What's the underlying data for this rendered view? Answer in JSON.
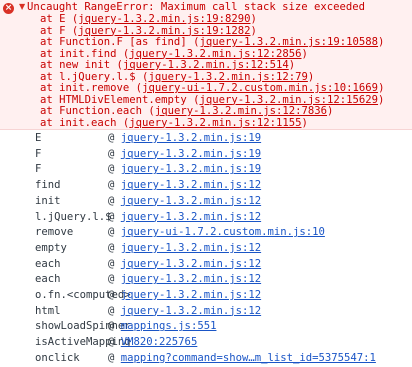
{
  "error": {
    "icon": "error-circle-icon",
    "toggle_icon": "triangle-down-icon",
    "message": "Uncaught RangeError: Maximum call stack size exceeded",
    "frames": [
      {
        "prefix": "at E (",
        "link": "jquery-1.3.2.min.js:19:8290",
        "suffix": ")"
      },
      {
        "prefix": "at F (",
        "link": "jquery-1.3.2.min.js:19:1282",
        "suffix": ")"
      },
      {
        "prefix": "at Function.F [as find] (",
        "link": "jquery-1.3.2.min.js:19:10588",
        "suffix": ")"
      },
      {
        "prefix": "at init.find (",
        "link": "jquery-1.3.2.min.js:12:2856",
        "suffix": ")"
      },
      {
        "prefix": "at new init (",
        "link": "jquery-1.3.2.min.js:12:514",
        "suffix": ")"
      },
      {
        "prefix": "at l.jQuery.l.$ (",
        "link": "jquery-1.3.2.min.js:12:79",
        "suffix": ")"
      },
      {
        "prefix": "at init.remove (",
        "link": "jquery-ui-1.7.2.custom.min.js:10:1669",
        "suffix": ")"
      },
      {
        "prefix": "at HTMLDivElement.empty (",
        "link": "jquery-1.3.2.min.js:12:15629",
        "suffix": ")"
      },
      {
        "prefix": "at Function.each (",
        "link": "jquery-1.3.2.min.js:12:7836",
        "suffix": ")"
      },
      {
        "prefix": "at init.each (",
        "link": "jquery-1.3.2.min.js:12:1155",
        "suffix": ")"
      }
    ]
  },
  "stack": {
    "at_symbol": "@",
    "rows": [
      {
        "fn": "E",
        "src": "jquery-1.3.2.min.js:19"
      },
      {
        "fn": "F",
        "src": "jquery-1.3.2.min.js:19"
      },
      {
        "fn": "F",
        "src": "jquery-1.3.2.min.js:19"
      },
      {
        "fn": "find",
        "src": "jquery-1.3.2.min.js:12"
      },
      {
        "fn": "init",
        "src": "jquery-1.3.2.min.js:12"
      },
      {
        "fn": "l.jQuery.l.$",
        "src": "jquery-1.3.2.min.js:12"
      },
      {
        "fn": "remove",
        "src": "jquery-ui-1.7.2.custom.min.js:10"
      },
      {
        "fn": "empty",
        "src": "jquery-1.3.2.min.js:12"
      },
      {
        "fn": "each",
        "src": "jquery-1.3.2.min.js:12"
      },
      {
        "fn": "each",
        "src": "jquery-1.3.2.min.js:12"
      },
      {
        "fn": "o.fn.<computed>",
        "src": "jquery-1.3.2.min.js:12"
      },
      {
        "fn": "html",
        "src": "jquery-1.3.2.min.js:12"
      },
      {
        "fn": "showLoadSpinner",
        "src": "mappings.js:551"
      },
      {
        "fn": "isActiveMapping",
        "src": "VM820:225765"
      },
      {
        "fn": "onclick",
        "src": "mapping?command=show…m_list_id=5375547:1"
      }
    ]
  }
}
